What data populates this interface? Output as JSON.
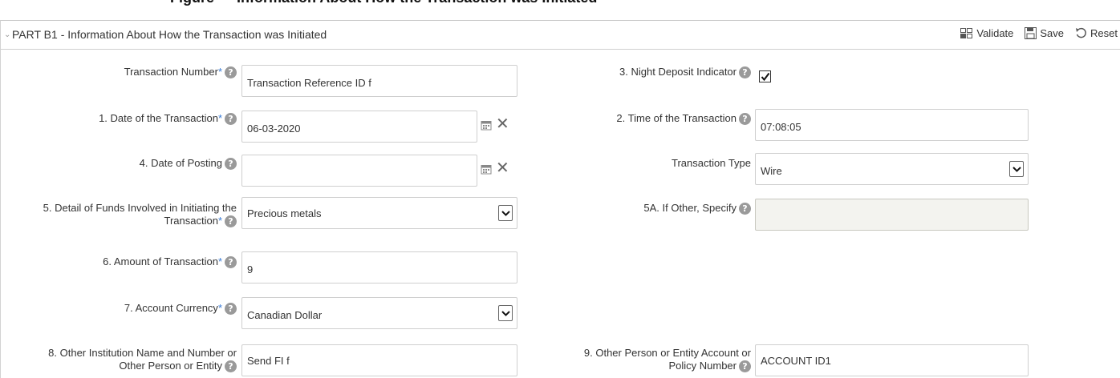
{
  "caption": "Figure — Information About How the Transaction was Initiated",
  "panel": {
    "title": "PART B1 - Information About How the Transaction was Initiated",
    "toolbar": {
      "validate": "Validate",
      "save": "Save",
      "reset": "Reset"
    }
  },
  "form": {
    "transaction_number": {
      "label": "Transaction Number",
      "required": "*",
      "value": "Transaction Reference ID f"
    },
    "night_deposit": {
      "label": "3. Night Deposit Indicator",
      "checked": true
    },
    "date_of_transaction": {
      "label": "1. Date of the Transaction",
      "required": "*",
      "value": "06-03-2020"
    },
    "time_of_transaction": {
      "label": "2. Time of the Transaction",
      "value": "07:08:05"
    },
    "date_of_posting": {
      "label": "4. Date of Posting",
      "value": ""
    },
    "transaction_type": {
      "label": "Transaction Type",
      "value": "Wire"
    },
    "detail_of_funds": {
      "label_line1": "5. Detail of Funds Involved in Initiating the",
      "label_line2": "Transaction",
      "required": "*",
      "value": "Precious metals"
    },
    "other_specify": {
      "label": "5A. If Other, Specify",
      "value": ""
    },
    "amount": {
      "label": "6. Amount of Transaction",
      "required": "*",
      "value": "9"
    },
    "account_currency": {
      "label": "7. Account Currency",
      "required": "*",
      "value": "Canadian Dollar"
    },
    "other_institution": {
      "label_line1": "8. Other Institution Name and Number or",
      "label_line2": "Other Person or Entity",
      "value": "Send FI f"
    },
    "other_account": {
      "label_line1": "9. Other Person or Entity Account or",
      "label_line2": "Policy Number",
      "value": "ACCOUNT ID1"
    }
  },
  "icons": {
    "help": "?",
    "clear": "✕",
    "calendar": "calendar-icon"
  }
}
